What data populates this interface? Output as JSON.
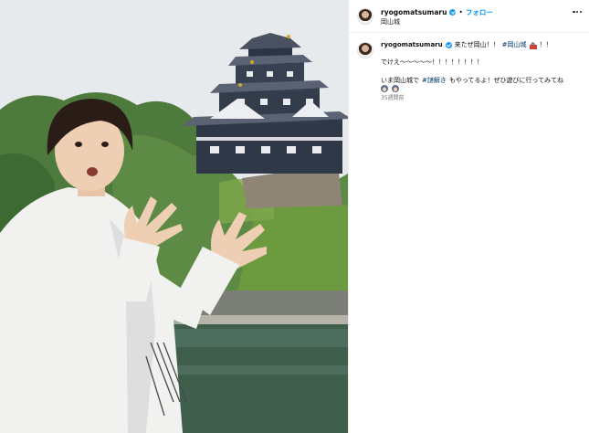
{
  "header": {
    "username": "ryogomatsumaru",
    "separator": "•",
    "follow_label": "フォロー",
    "location": "岡山城",
    "more_icon": "more-horizontal-icon"
  },
  "caption": {
    "username": "ryogomatsumaru",
    "line1_text": "来たぜ岡山！！",
    "line1_tag": "#岡山城",
    "line1_after": "！！",
    "line2": "でけえ〜〜〜〜〜！！！！！！！！",
    "line3_before": "いま岡山城で",
    "line3_tag": "#謎解き",
    "line3_after": "もやってるよ！ぜひ遊びに行ってみてね",
    "timestamp": "35週間前"
  },
  "colors": {
    "follow": "#0095f6",
    "hashtag": "#00376b",
    "verified": "#1d9bf0"
  }
}
